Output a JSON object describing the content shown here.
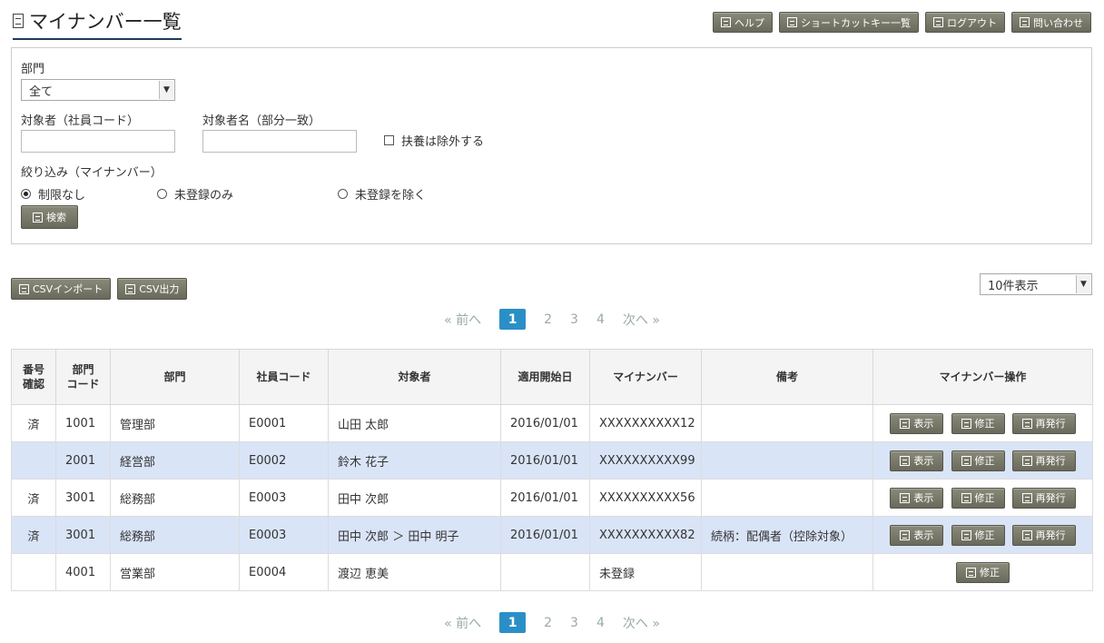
{
  "page": {
    "title": "マイナンバー一覧"
  },
  "header_buttons": [
    {
      "label": "ヘルプ"
    },
    {
      "label": "ショートカットキー一覧"
    },
    {
      "label": "ログアウト"
    },
    {
      "label": "問い合わせ"
    }
  ],
  "search": {
    "dept_label": "部門",
    "dept_value": "全て",
    "emp_code_label": "対象者（社員コード）",
    "emp_code_value": "",
    "name_label": "対象者名（部分一致）",
    "name_value": "",
    "exclude_dependents_label": "扶養は除外する",
    "filter_label": "絞り込み（マイナンバー）",
    "radio_options": [
      "制限なし",
      "未登録のみ",
      "未登録を除く"
    ],
    "radio_selected": "制限なし",
    "search_button": "検索"
  },
  "toolbar": {
    "csv_import": "CSVインポート",
    "csv_export": "CSV出力",
    "per_page": "10件表示"
  },
  "pagination": {
    "prev": "« 前へ",
    "pages": [
      "1",
      "2",
      "3",
      "4"
    ],
    "current": "1",
    "next": "次へ »"
  },
  "table": {
    "headers": {
      "confirm": "番号\n確認",
      "dept_code": "部門\nコード",
      "dept": "部門",
      "emp_code": "社員コード",
      "person": "対象者",
      "start_date": "適用開始日",
      "mynumber": "マイナンバー",
      "note": "備考",
      "ops": "マイナンバー操作"
    },
    "op_labels": {
      "view": "表示",
      "edit": "修正",
      "reissue": "再発行"
    },
    "rows": [
      {
        "confirm": "済",
        "dept_code": "1001",
        "dept": "管理部",
        "emp_code": "E0001",
        "person": "山田 太郎",
        "start_date": "2016/01/01",
        "mynumber": "XXXXXXXXXX12",
        "note": ""
      },
      {
        "confirm": "",
        "dept_code": "2001",
        "dept": "経営部",
        "emp_code": "E0002",
        "person": "鈴木 花子",
        "start_date": "2016/01/01",
        "mynumber": "XXXXXXXXXX99",
        "note": ""
      },
      {
        "confirm": "済",
        "dept_code": "3001",
        "dept": "総務部",
        "emp_code": "E0003",
        "person": "田中 次郎",
        "start_date": "2016/01/01",
        "mynumber": "XXXXXXXXXX56",
        "note": ""
      },
      {
        "confirm": "済",
        "dept_code": "3001",
        "dept": "総務部",
        "emp_code": "E0003",
        "person": "田中 次郎 ＞ 田中 明子",
        "start_date": "2016/01/01",
        "mynumber": "XXXXXXXXXX82",
        "note": "続柄：配偶者（控除対象）"
      },
      {
        "confirm": "",
        "dept_code": "4001",
        "dept": "営業部",
        "emp_code": "E0004",
        "person": "渡辺 恵美",
        "start_date": "",
        "mynumber": "未登録",
        "note": ""
      }
    ]
  },
  "colors": {
    "accent": "#2b8fc7",
    "button": "#77776a",
    "row_alt": "#d9e4f7",
    "unregistered": "#e02020"
  }
}
